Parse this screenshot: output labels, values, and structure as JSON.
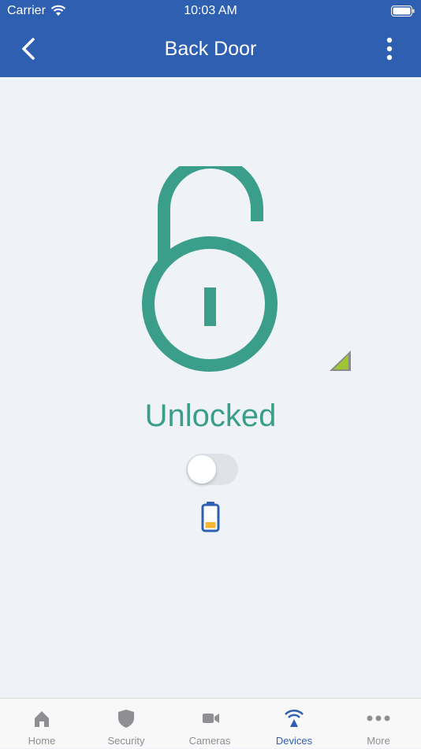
{
  "status_bar": {
    "carrier": "Carrier",
    "time": "10:03 AM"
  },
  "header": {
    "title": "Back Door"
  },
  "lock": {
    "status": "Unlocked",
    "toggle_on": false,
    "battery_level": 0.25,
    "color": "#3a9e8a"
  },
  "tabbar": {
    "tabs": [
      {
        "label": "Home",
        "icon": "home-icon"
      },
      {
        "label": "Security",
        "icon": "shield-icon"
      },
      {
        "label": "Cameras",
        "icon": "camera-icon"
      },
      {
        "label": "Devices",
        "icon": "devices-icon",
        "active": true
      },
      {
        "label": "More",
        "icon": "more-icon"
      }
    ]
  },
  "colors": {
    "accent": "#2e5fb0",
    "background": "#eff3f7",
    "lock": "#3a9e8a"
  }
}
